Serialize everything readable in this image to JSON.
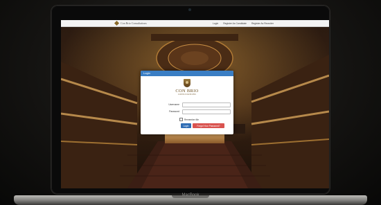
{
  "nav": {
    "logo_text": "Con Brio Consultations",
    "links": [
      "Login",
      "Register As Candidate",
      "Register As Recruiter"
    ]
  },
  "login": {
    "header": "Login",
    "brand_name": "CON BRIO",
    "brand_tagline": "CONSULTATIONS",
    "username_label": "Username",
    "password_label": "Password",
    "remember_label": "Remember Me",
    "login_button": "Login",
    "forgot_button": "Forgot Your Password?"
  },
  "device": {
    "label": "MacBook"
  },
  "colors": {
    "modal_header": "#3a7ec4",
    "login_button": "#2f6db5",
    "forgot_button": "#d9534f",
    "brand_gold": "#6b4e1f"
  },
  "icons": {
    "logo": "crest-icon",
    "camera": "camera-icon"
  }
}
